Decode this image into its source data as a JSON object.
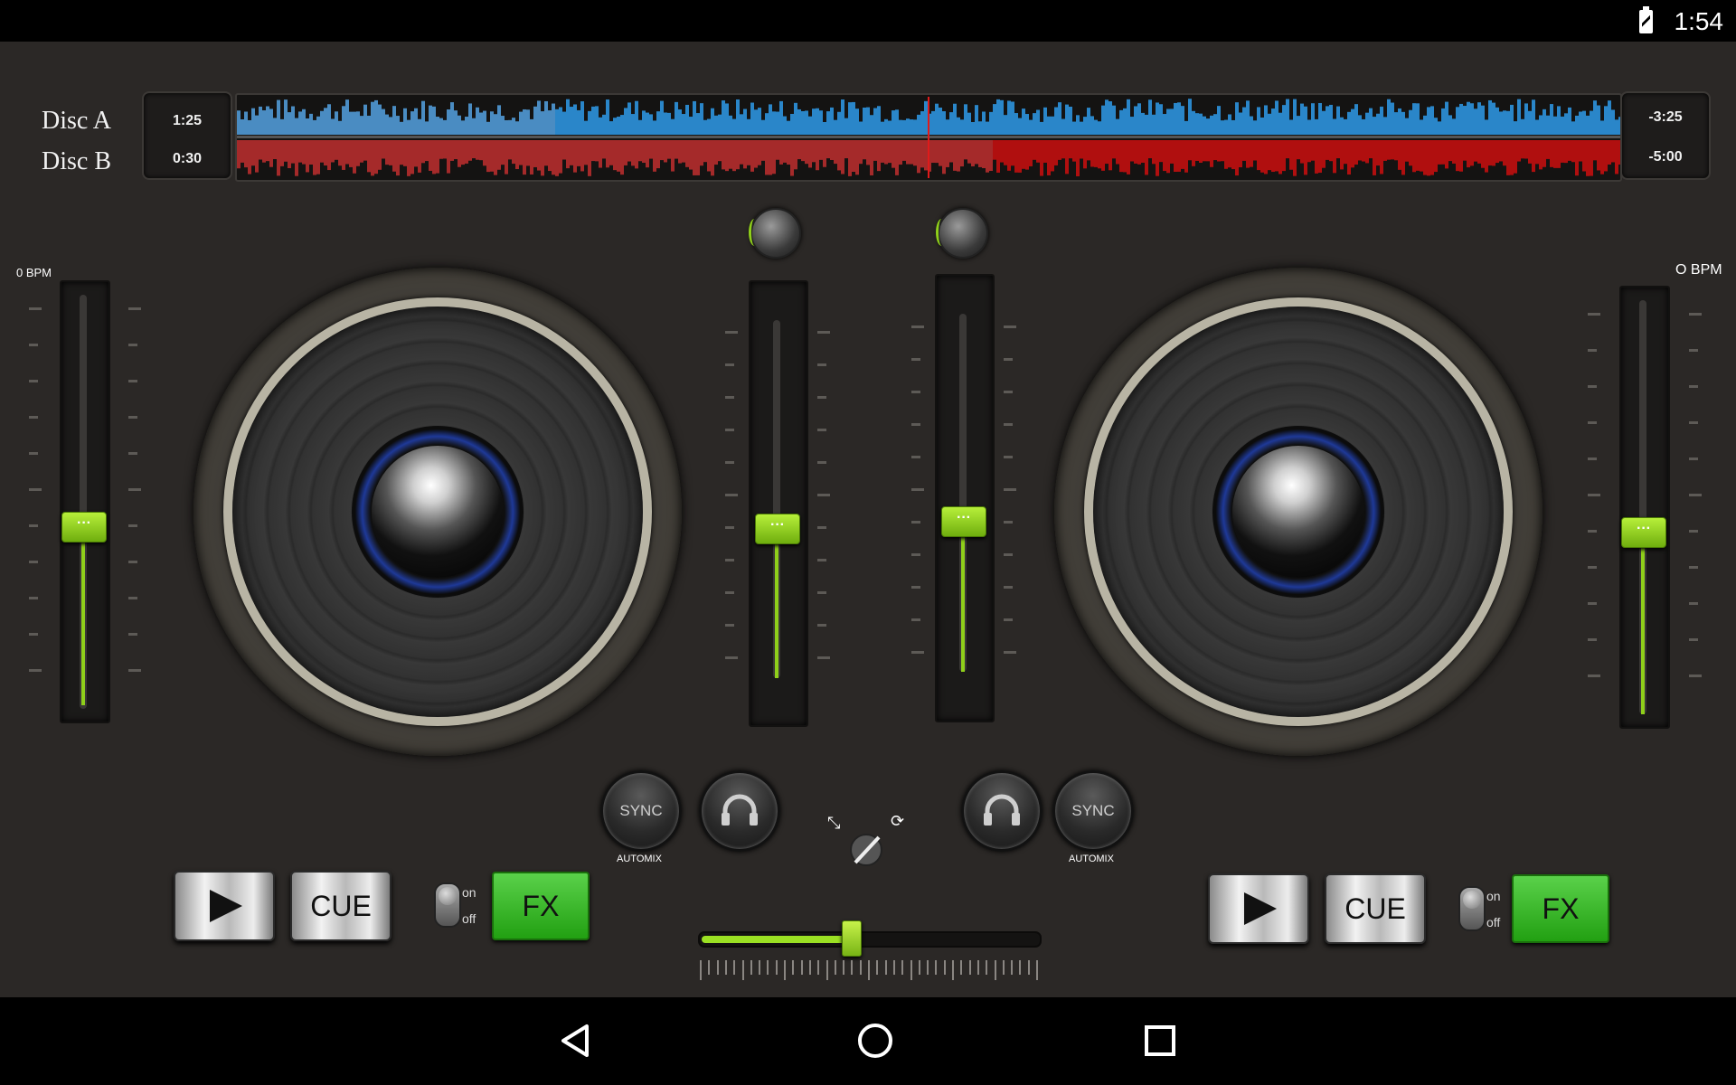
{
  "status_bar": {
    "time": "1:54",
    "battery_icon": "battery-charging-icon"
  },
  "decks": {
    "labels": {
      "disc_a": "Disc A",
      "disc_b": "Disc B"
    },
    "elapsed": {
      "disc_a": "1:25",
      "disc_b": "0:30"
    },
    "remaining": {
      "disc_a": "-3:25",
      "disc_b": "-5:00"
    },
    "waveform_colors": {
      "disc_a": "#2a86c9",
      "disc_b": "#b00f0f"
    },
    "left": {
      "bpm": "0 BPM",
      "sync": "SYNC",
      "automix": "AUTOMIX",
      "cue": "CUE",
      "fx": "FX",
      "on": "on",
      "off": "off"
    },
    "right": {
      "bpm": "O BPM",
      "sync": "SYNC",
      "automix": "AUTOMIX",
      "cue": "CUE",
      "fx": "FX",
      "on": "on",
      "off": "off"
    }
  },
  "crossfader": {
    "position_percent": 45
  },
  "colors": {
    "accent": "#8fcf1a",
    "fx_green": "#2bb01a",
    "background": "#2b2826"
  }
}
